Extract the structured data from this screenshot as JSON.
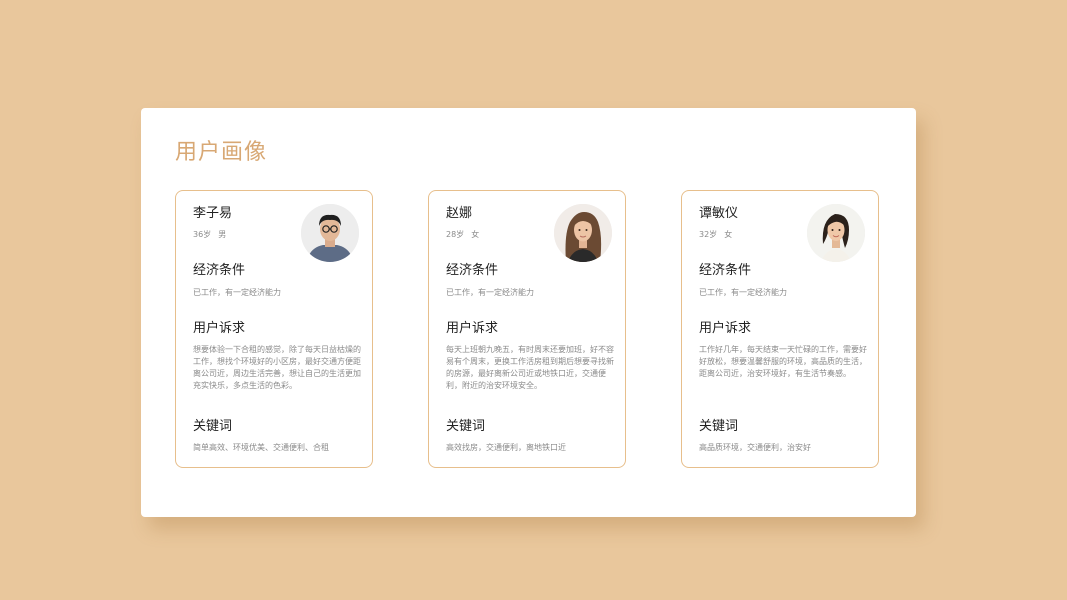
{
  "page": {
    "title": "用户画像"
  },
  "section_labels": {
    "economy": "经济条件",
    "appeal": "用户诉求",
    "keywords": "关键词"
  },
  "personas": [
    {
      "name": "李子易",
      "age": "36岁",
      "gender": "男",
      "economy": "已工作，有一定经济能力",
      "appeal": "想要体验一下合租的感觉，除了每天日益枯燥的工作，想找个环境好的小区房，最好交通方便距离公司近，周边生活完善，想让自己的生活更加充实快乐，多点生活的色彩。",
      "keywords": "简单高效、环境优美、交通便利、合租",
      "avatar_icon": "man-portrait-icon"
    },
    {
      "name": "赵娜",
      "age": "28岁",
      "gender": "女",
      "economy": "已工作，有一定经济能力",
      "appeal": "每天上班朝九晚五，有时周末还要加班，好不容易有个周末，更换工作活房租到期后想要寻找新的房源，最好离新公司近或地铁口近，交通便利，附近的治安环境安全。",
      "keywords": "高效找房，交通便利，离地铁口近",
      "avatar_icon": "woman-portrait-icon"
    },
    {
      "name": "谭敏仪",
      "age": "32岁",
      "gender": "女",
      "economy": "已工作，有一定经济能力",
      "appeal": "工作好几年，每天结束一天忙碌的工作，需要好好放松，想要温馨舒服的环境，高品质的生活，距离公司近，治安环境好，有生活节奏感。",
      "keywords": "高品质环境，交通便利，治安好",
      "avatar_icon": "woman-portrait-icon"
    }
  ],
  "colors": {
    "background": "#e9c79c",
    "accent": "#d8a874",
    "card_border": "#e7bf8c"
  }
}
